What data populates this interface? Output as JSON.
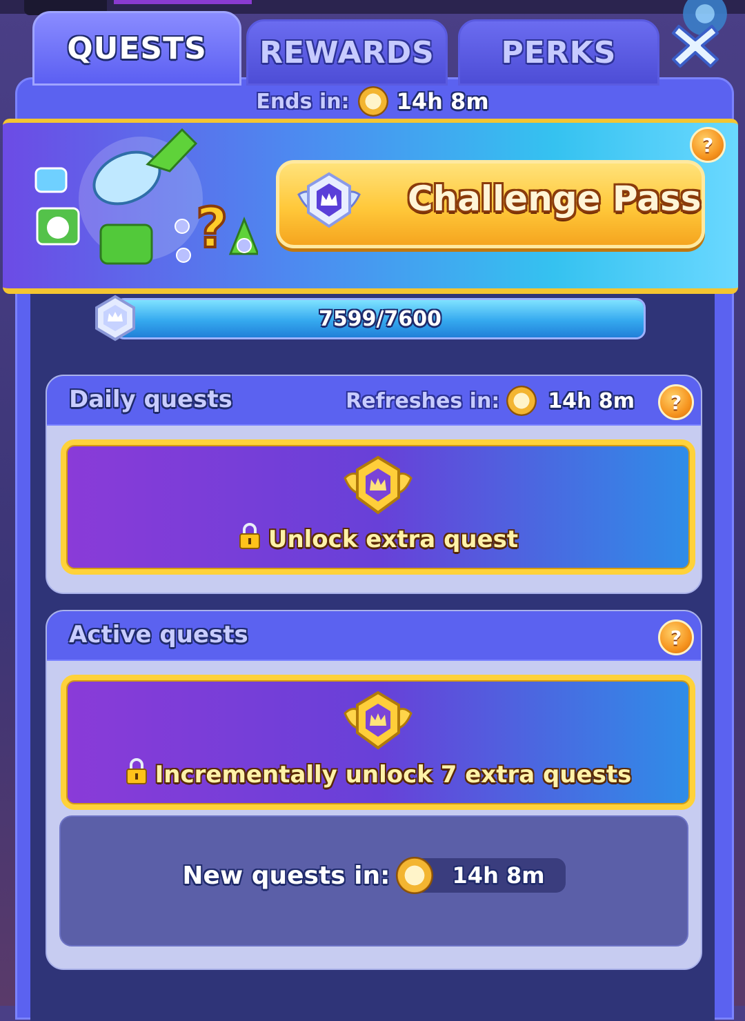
{
  "tabs": {
    "quests": "QUESTS",
    "rewards": "REWARDS",
    "perks": "PERKS"
  },
  "ends": {
    "label": "Ends in:",
    "value": "14h 8m"
  },
  "banner": {
    "button_label": "Challenge Pass",
    "help": "?"
  },
  "progress": {
    "text": "7599/7600",
    "current": 7599,
    "max": 7600
  },
  "daily": {
    "title": "Daily quests",
    "refresh_label": "Refreshes in:",
    "refresh_value": "14h 8m",
    "help": "?",
    "card_label": "Unlock extra quest"
  },
  "active": {
    "title": "Active quests",
    "help": "?",
    "card_label": "Incrementally unlock 7 extra quests",
    "new_label": "New quests in:",
    "new_value": "14h 8m"
  },
  "colors": {
    "panel": "#5b62f0",
    "gold": "#f4c531",
    "card_border": "#ffd23a"
  }
}
